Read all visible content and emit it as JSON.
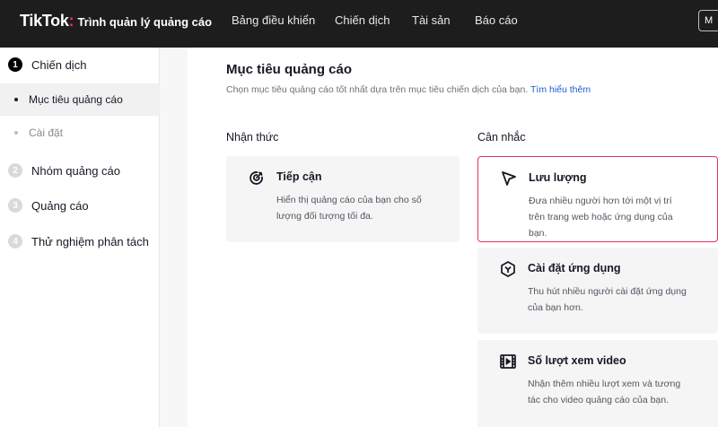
{
  "brand": {
    "logo": "TikTok",
    "colon": ":",
    "app_name": "Trình quản lý quảng cáo"
  },
  "nav": [
    {
      "label": "Bảng điều khiển"
    },
    {
      "label": "Chiến dịch"
    },
    {
      "label": "Tài sản"
    },
    {
      "label": "Báo cáo"
    }
  ],
  "top_button": {
    "label": "M"
  },
  "sidebar": {
    "steps": [
      {
        "number": "1",
        "label": "Chiến dịch",
        "active": true
      },
      {
        "number": "2",
        "label": "Nhóm quảng cáo"
      },
      {
        "number": "3",
        "label": "Quảng cáo"
      },
      {
        "number": "4",
        "label": "Thử nghiệm phân tách"
      }
    ],
    "substeps": [
      {
        "label": "Mục tiêu quảng cáo",
        "active": true
      },
      {
        "label": "Cài đặt"
      }
    ]
  },
  "main": {
    "title": "Mục tiêu quảng cáo",
    "subtitle": "Chọn mục tiêu quảng cáo tốt nhất dựa trên mục tiêu chiến dịch của bạn.",
    "learn_more": "Tìm hiểu thêm",
    "columns": [
      {
        "title": "Nhận thức",
        "cards": [
          {
            "icon": "target-icon",
            "title": "Tiếp cận",
            "description": "Hiển thị quảng cáo của bạn cho số lượng đối tượng tối đa."
          }
        ]
      },
      {
        "title": "Cân nhắc",
        "cards": [
          {
            "icon": "cursor-icon",
            "title": "Lưu lượng",
            "description": "Đưa nhiều người hơn tới một vị trí trên trang web hoặc ứng dụng của bạn.",
            "selected": true
          },
          {
            "icon": "cube-icon",
            "title": "Cài đặt ứng dụng",
            "description": "Thu hút nhiều người cài đặt ứng dụng của bạn hơn."
          },
          {
            "icon": "video-icon",
            "title": "Số lượt xem video",
            "description": "Nhận thêm nhiều lượt xem và tương tác cho video quảng cáo của bạn."
          }
        ]
      }
    ]
  },
  "colors": {
    "accent": "#e8315b",
    "link": "#1a5fd1",
    "topbar": "#1d1d1d"
  }
}
